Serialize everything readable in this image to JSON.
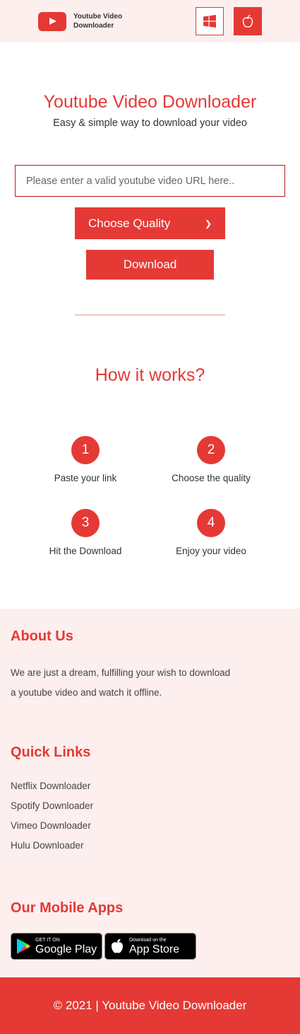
{
  "header": {
    "brand": "Youtube Video Downloader",
    "icons": {
      "logo": "youtube-play-icon",
      "windows": "windows-icon",
      "apple": "apple-icon"
    }
  },
  "hero": {
    "title": "Youtube Video Downloader",
    "subtitle": "Easy & simple way to download your video",
    "url_placeholder": "Please enter a valid youtube video URL here..",
    "quality_label": "Choose Quality",
    "download_label": "Download"
  },
  "how": {
    "title": "How it works?",
    "steps": [
      {
        "num": "1",
        "label": "Paste your link"
      },
      {
        "num": "2",
        "label": "Choose the quality"
      },
      {
        "num": "3",
        "label": "Hit the Download"
      },
      {
        "num": "4",
        "label": "Enjoy your video"
      }
    ]
  },
  "about": {
    "title": "About Us",
    "line1": "We are just a dream, fulfilling your wish to download",
    "line2": "a youtube video and watch it offline."
  },
  "quick_links": {
    "title": "Quick Links",
    "items": [
      "Netflix Downloader",
      "Spotify Downloader",
      "Vimeo Downloader",
      "Hulu Downloader"
    ]
  },
  "apps": {
    "title": "Our Mobile Apps",
    "google_small": "GET IT ON",
    "google_big": "Google Play",
    "apple_small": "Download on the",
    "apple_big": "App Store"
  },
  "footer": {
    "copyright": "© 2021 | Youtube Video Downloader"
  },
  "colors": {
    "accent": "#e53935",
    "header_bg": "#fcefee"
  }
}
